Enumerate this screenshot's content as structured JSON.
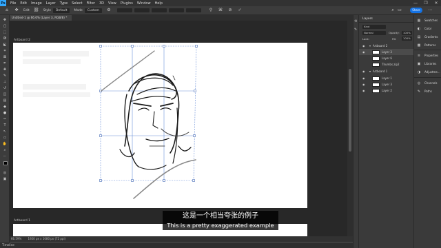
{
  "menubar": {
    "logo": "Ps",
    "items": [
      "File",
      "Edit",
      "Image",
      "Layer",
      "Type",
      "Select",
      "Filter",
      "3D",
      "View",
      "Plugins",
      "Window",
      "Help"
    ],
    "minimize": "—",
    "maximize": "❐",
    "close": "✕"
  },
  "options": {
    "edit_label": "Edit",
    "width_label": "Style",
    "style_value": "Default",
    "mode_label": "Mode",
    "mode_value": "Custom",
    "share_label": "Share"
  },
  "document": {
    "tab_title": "Untitled-1 @ 66.6% (Layer 3, RGB/8) *",
    "artboard2_label": "Artboard 2",
    "artboard1_label": "Artboard 1"
  },
  "status": {
    "zoom": "66.59%",
    "doc_info": "1920 px x 1080 px (72 ppi)"
  },
  "timeline": {
    "label": "Timeline"
  },
  "layers_panel": {
    "title": "Layers",
    "kind_value": "Kind",
    "blend_value": "Normal",
    "opacity_label": "Opacity:",
    "opacity_value": "100%",
    "lock_label": "Lock:",
    "fill_label": "Fill:",
    "fill_value": "100%",
    "layers": [
      {
        "name": "Artboard 2",
        "type": "group",
        "selected": false
      },
      {
        "name": "Layer 3",
        "type": "layer",
        "selected": true
      },
      {
        "name": "Layer 6",
        "type": "layer",
        "selected": false
      },
      {
        "name": "Thumbs.zip2",
        "type": "layer",
        "selected": false
      },
      {
        "name": "Artboard 1",
        "type": "group",
        "selected": false
      },
      {
        "name": "Layer 1",
        "type": "layer",
        "selected": false
      },
      {
        "name": "Layer 3",
        "type": "layer",
        "selected": false
      },
      {
        "name": "Layer 2",
        "type": "layer",
        "selected": false
      }
    ]
  },
  "right_panels": {
    "items": [
      {
        "label": "Swatches",
        "icon": "swatches-icon",
        "glyph": "▦"
      },
      {
        "label": "Color",
        "icon": "color-icon",
        "glyph": "◐"
      },
      {
        "label": "Gradients",
        "icon": "gradients-icon",
        "glyph": "▤"
      },
      {
        "label": "Patterns",
        "icon": "patterns-icon",
        "glyph": "▩"
      },
      {
        "label": "Properties",
        "icon": "properties-icon",
        "glyph": "≡"
      },
      {
        "label": "Libraries",
        "icon": "libraries-icon",
        "glyph": "▣"
      },
      {
        "label": "Adjustme...",
        "icon": "adjustments-icon",
        "glyph": "◑"
      },
      {
        "label": "Channels",
        "icon": "channels-icon",
        "glyph": "◎"
      },
      {
        "label": "Paths",
        "icon": "paths-icon",
        "glyph": "✎"
      }
    ]
  },
  "subtitles": {
    "zh": "这是一个相当夸张的例子",
    "en": "This is a pretty exaggerated example"
  },
  "colors": {
    "accent": "#31a8ff",
    "share": "#1473e6",
    "transform_guides": "#6a8fd8"
  }
}
